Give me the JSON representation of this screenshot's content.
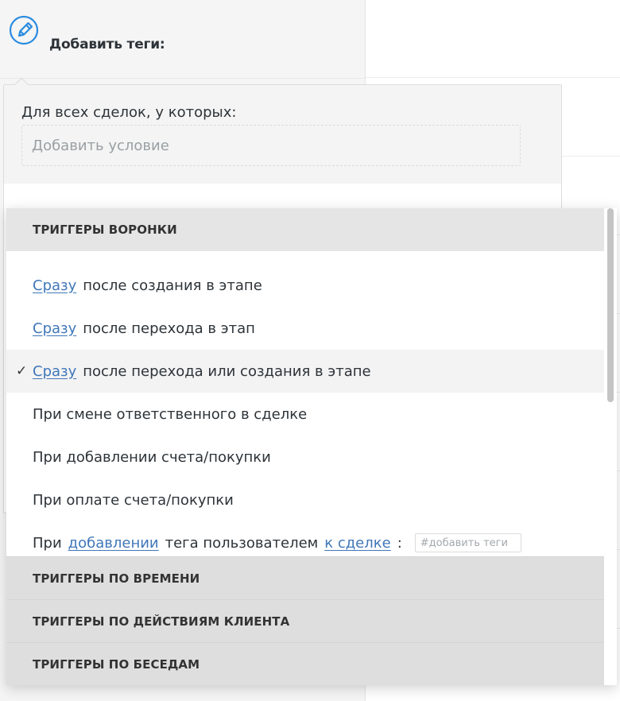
{
  "header": {
    "title": "Добавить теги:",
    "icon": "pencil-edit-icon",
    "accent_color": "#2a8be0"
  },
  "condition": {
    "label": "Для всех сделок, у которых:",
    "placeholder": "Добавить условие"
  },
  "dropdown": {
    "sections": [
      {
        "label": "ТРИГГЕРЫ ВОРОНКИ",
        "expanded": true
      },
      {
        "label": "ТРИГГЕРЫ ПО ВРЕМЕНИ",
        "expanded": false
      },
      {
        "label": "ТРИГГЕРЫ ПО ДЕЙСТВИЯМ КЛИЕНТА",
        "expanded": false
      },
      {
        "label": "ТРИГГЕРЫ ПО БЕСЕДАМ",
        "expanded": false
      }
    ],
    "options": [
      {
        "link": "Сразу",
        "text": "после создания в этапе",
        "selected": false
      },
      {
        "link": "Сразу",
        "text": "после перехода в этап",
        "selected": false
      },
      {
        "link": "Сразу",
        "text": "после перехода или создания в этапе",
        "selected": true,
        "check": "✓"
      },
      {
        "text": "При смене ответственного в сделке",
        "selected": false
      },
      {
        "text": "При добавлении счета/покупки",
        "selected": false
      },
      {
        "text": "При оплате счета/покупки",
        "selected": false
      }
    ],
    "tag_option": {
      "prefix": "При",
      "link1": "добавлении",
      "middle": "тега пользователем",
      "link2": "к сделке",
      "suffix": ":",
      "tag_placeholder": "#добавить теги"
    },
    "link_color": "#4077b8"
  }
}
